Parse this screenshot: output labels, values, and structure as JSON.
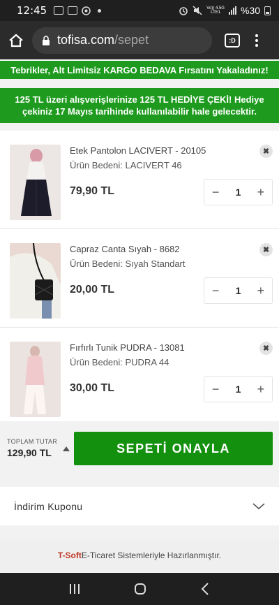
{
  "status_bar": {
    "time": "12:45",
    "network": "Vo)) 4.5G",
    "network_sub": "LTE1",
    "battery": "%30"
  },
  "browser": {
    "domain": "tofisa.com",
    "path": "/sepet",
    "tab_switcher_label": ":D"
  },
  "banners": {
    "shipping": "Tebrikler, Alt Limitsiz KARGO BEDAVA Fırsatını Yakaladınız!",
    "gift": "125 TL üzeri alışverişlerinize 125 TL HEDİYE ÇEKİ! Hediye çekiniz 17 Mayıs tarihinde kullanılabilir hale gelecektir."
  },
  "cart": {
    "items": [
      {
        "name": "Etek Pantolon LACIVERT - 20105",
        "size": "Ürün Bedeni: LACIVERT 46",
        "price": "79,90 TL",
        "quantity": "1"
      },
      {
        "name": "Capraz Canta Sıyah - 8682",
        "size": "Ürün Bedeni: Sıyah Standart",
        "price": "20,00 TL",
        "quantity": "1"
      },
      {
        "name": "Fırfırlı Tunik PUDRA - 13081",
        "size": "Ürün Bedeni: PUDRA 44",
        "price": "30,00 TL",
        "quantity": "1"
      }
    ],
    "minus": "−",
    "plus": "+",
    "remove": "✖"
  },
  "total": {
    "label": "TOPLAM TUTAR",
    "amount": "129,90 TL",
    "confirm_button": "SEPETİ ONAYLA"
  },
  "coupon": {
    "label": "İndirim Kuponu"
  },
  "footer": {
    "brand": "T-Soft",
    "text": " E-Ticaret Sistemleriyle Hazırlanmıştır."
  },
  "colors": {
    "banner_green": "#1e9b1e",
    "button_green": "#14900f",
    "brand_red": "#c0392b"
  }
}
